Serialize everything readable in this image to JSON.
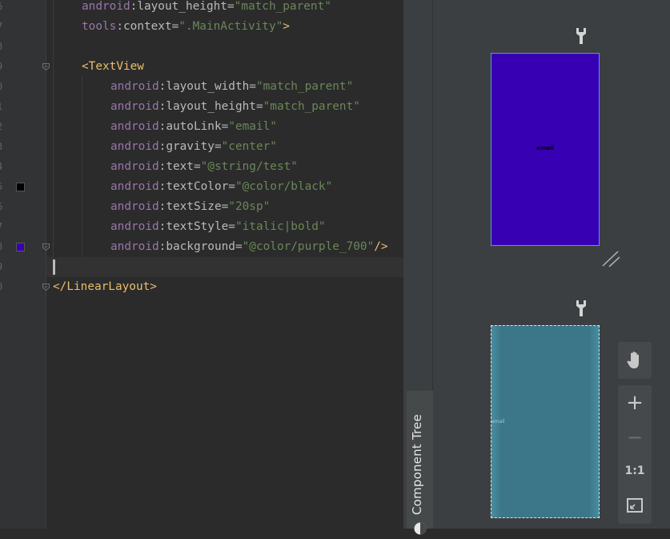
{
  "editor": {
    "line_numbers": [
      "6",
      "7",
      "8",
      "9",
      "0",
      "1",
      "2",
      "3",
      "4",
      "5",
      "6",
      "7",
      "8",
      "9",
      "0"
    ],
    "lines": [
      [
        {
          "c": "ns",
          "t": "android"
        },
        {
          "c": "attr",
          "t": ":layout_height="
        },
        {
          "c": "str",
          "t": "\"match_parent\""
        }
      ],
      [
        {
          "c": "ns",
          "t": "tools"
        },
        {
          "c": "attr",
          "t": ":context="
        },
        {
          "c": "str",
          "t": "\".MainActivity\""
        },
        {
          "c": "tag",
          "t": ">"
        }
      ],
      [],
      [
        {
          "c": "tag",
          "t": "<TextView"
        }
      ],
      [
        {
          "c": "ns",
          "t": "android"
        },
        {
          "c": "attr",
          "t": ":layout_width="
        },
        {
          "c": "str",
          "t": "\"match_parent\""
        }
      ],
      [
        {
          "c": "ns",
          "t": "android"
        },
        {
          "c": "attr",
          "t": ":layout_height="
        },
        {
          "c": "str",
          "t": "\"match_parent\""
        }
      ],
      [
        {
          "c": "ns",
          "t": "android"
        },
        {
          "c": "attr",
          "t": ":autoLink="
        },
        {
          "c": "str",
          "t": "\"email\""
        }
      ],
      [
        {
          "c": "ns",
          "t": "android"
        },
        {
          "c": "attr",
          "t": ":gravity="
        },
        {
          "c": "str",
          "t": "\"center\""
        }
      ],
      [
        {
          "c": "ns",
          "t": "android"
        },
        {
          "c": "attr",
          "t": ":text="
        },
        {
          "c": "str",
          "t": "\"@string/test\""
        }
      ],
      [
        {
          "c": "ns",
          "t": "android"
        },
        {
          "c": "attr",
          "t": ":textColor="
        },
        {
          "c": "str",
          "t": "\"@color/black\""
        }
      ],
      [
        {
          "c": "ns",
          "t": "android"
        },
        {
          "c": "attr",
          "t": ":textSize="
        },
        {
          "c": "str",
          "t": "\"20sp\""
        }
      ],
      [
        {
          "c": "ns",
          "t": "android"
        },
        {
          "c": "attr",
          "t": ":textStyle="
        },
        {
          "c": "str",
          "t": "\"italic|bold\""
        }
      ],
      [
        {
          "c": "ns",
          "t": "android"
        },
        {
          "c": "attr",
          "t": ":background="
        },
        {
          "c": "str",
          "t": "\"@color/purple_700\""
        },
        {
          "c": "tag",
          "t": "/>"
        }
      ],
      [],
      [
        {
          "c": "tag",
          "t": "</LinearLayout>"
        }
      ]
    ],
    "indent_levels": [
      1,
      1,
      0,
      1,
      2,
      2,
      2,
      2,
      2,
      2,
      2,
      2,
      2,
      0,
      0
    ],
    "swatches": [
      {
        "line": 9,
        "color": "#000000"
      },
      {
        "line": 12,
        "color": "#3700b3"
      }
    ],
    "fold_lines": [
      3,
      12,
      14
    ],
    "current_line": 13
  },
  "panel": {
    "component_tree_label": "Component Tree"
  },
  "preview": {
    "design_text": "email",
    "design_bg": "#3700b3",
    "blueprint_text": "email",
    "blueprint_bg": "#3b7789"
  },
  "toolbar": {
    "pan_icon": "hand-icon",
    "zoom_in_label": "+",
    "zoom_out_label": "−",
    "actual_size_label": "1:1",
    "fit_icon": "zoom-to-fit-icon"
  }
}
